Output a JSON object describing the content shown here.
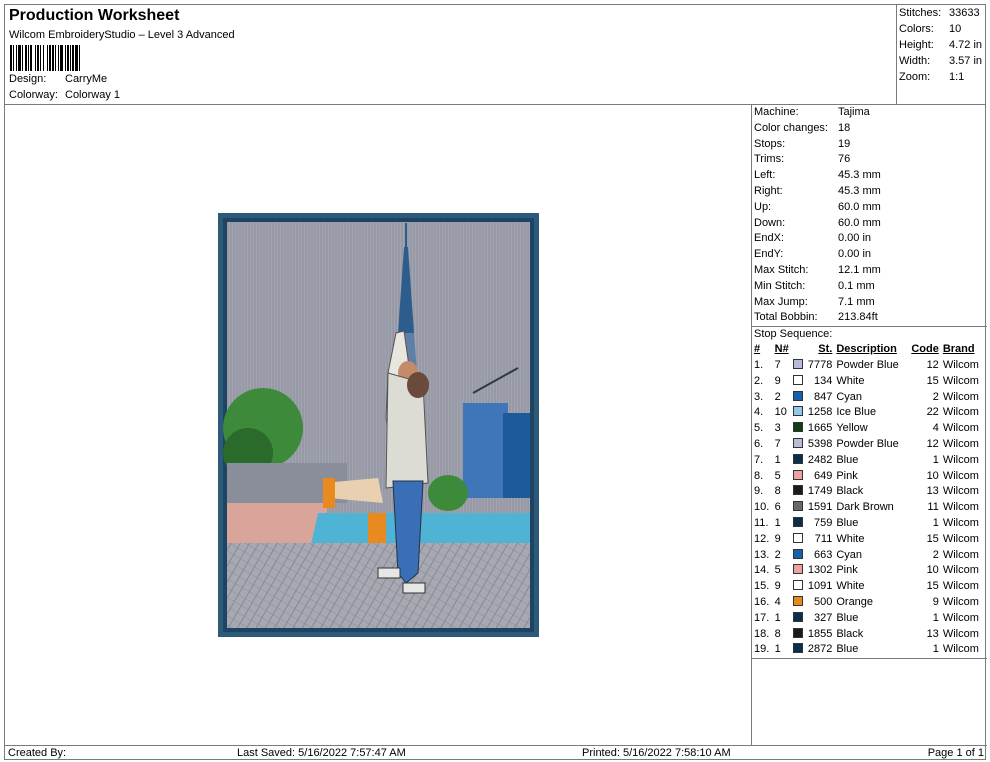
{
  "header": {
    "title": "Production Worksheet",
    "subtitle": "Wilcom EmbroideryStudio – Level 3 Advanced",
    "design_label": "Design:",
    "design_value": "CarryMe",
    "colorway_label": "Colorway:",
    "colorway_value": "Colorway 1"
  },
  "stats": [
    {
      "label": "Stitches:",
      "value": "33633"
    },
    {
      "label": "Colors:",
      "value": "10"
    },
    {
      "label": "Height:",
      "value": "4.72 in"
    },
    {
      "label": "Width:",
      "value": "3.57 in"
    },
    {
      "label": "Zoom:",
      "value": "1:1"
    }
  ],
  "machine_info": [
    {
      "label": "Machine:",
      "value": "Tajima"
    },
    {
      "label": "Color changes:",
      "value": "18"
    },
    {
      "label": "Stops:",
      "value": "19"
    },
    {
      "label": "Trims:",
      "value": "76"
    },
    {
      "label": "Left:",
      "value": "45.3 mm"
    },
    {
      "label": "Right:",
      "value": "45.3 mm"
    },
    {
      "label": "Up:",
      "value": "60.0 mm"
    },
    {
      "label": "Down:",
      "value": "60.0 mm"
    },
    {
      "label": "EndX:",
      "value": "0.00 in"
    },
    {
      "label": "EndY:",
      "value": "0.00 in"
    },
    {
      "label": "Max Stitch:",
      "value": "12.1 mm"
    },
    {
      "label": "Min Stitch:",
      "value": "0.1 mm"
    },
    {
      "label": "Max Jump:",
      "value": "7.1 mm"
    },
    {
      "label": "Total Bobbin:",
      "value": "213.84ft"
    }
  ],
  "stop_sequence": {
    "title": "Stop Sequence:",
    "columns": [
      "#",
      "N#",
      "St.",
      "Description",
      "Code",
      "Brand"
    ],
    "rows": [
      {
        "num": "1.",
        "n": "7",
        "color": "#b9bcd9",
        "st": "7778",
        "desc": "Powder Blue",
        "code": "12",
        "brand": "Wilcom"
      },
      {
        "num": "2.",
        "n": "9",
        "color": "#ffffff",
        "st": "134",
        "desc": "White",
        "code": "15",
        "brand": "Wilcom"
      },
      {
        "num": "3.",
        "n": "2",
        "color": "#1a5fae",
        "st": "847",
        "desc": "Cyan",
        "code": "2",
        "brand": "Wilcom"
      },
      {
        "num": "4.",
        "n": "10",
        "color": "#8fc9ea",
        "st": "1258",
        "desc": "Ice Blue",
        "code": "22",
        "brand": "Wilcom"
      },
      {
        "num": "5.",
        "n": "3",
        "color": "#123d12",
        "st": "1665",
        "desc": "Yellow",
        "code": "4",
        "brand": "Wilcom"
      },
      {
        "num": "6.",
        "n": "7",
        "color": "#b9bcd9",
        "st": "5398",
        "desc": "Powder Blue",
        "code": "12",
        "brand": "Wilcom"
      },
      {
        "num": "7.",
        "n": "1",
        "color": "#0d2d4e",
        "st": "2482",
        "desc": "Blue",
        "code": "1",
        "brand": "Wilcom"
      },
      {
        "num": "8.",
        "n": "5",
        "color": "#efa1a1",
        "st": "649",
        "desc": "Pink",
        "code": "10",
        "brand": "Wilcom"
      },
      {
        "num": "9.",
        "n": "8",
        "color": "#1b1b1b",
        "st": "1749",
        "desc": "Black",
        "code": "13",
        "brand": "Wilcom"
      },
      {
        "num": "10.",
        "n": "6",
        "color": "#6c6868",
        "st": "1591",
        "desc": "Dark Brown",
        "code": "11",
        "brand": "Wilcom"
      },
      {
        "num": "11.",
        "n": "1",
        "color": "#0d2d4e",
        "st": "759",
        "desc": "Blue",
        "code": "1",
        "brand": "Wilcom"
      },
      {
        "num": "12.",
        "n": "9",
        "color": "#ffffff",
        "st": "711",
        "desc": "White",
        "code": "15",
        "brand": "Wilcom"
      },
      {
        "num": "13.",
        "n": "2",
        "color": "#1a5fae",
        "st": "663",
        "desc": "Cyan",
        "code": "2",
        "brand": "Wilcom"
      },
      {
        "num": "14.",
        "n": "5",
        "color": "#efa1a1",
        "st": "1302",
        "desc": "Pink",
        "code": "10",
        "brand": "Wilcom"
      },
      {
        "num": "15.",
        "n": "9",
        "color": "#ffffff",
        "st": "1091",
        "desc": "White",
        "code": "15",
        "brand": "Wilcom"
      },
      {
        "num": "16.",
        "n": "4",
        "color": "#e88a1d",
        "st": "500",
        "desc": "Orange",
        "code": "9",
        "brand": "Wilcom"
      },
      {
        "num": "17.",
        "n": "1",
        "color": "#0d2d4e",
        "st": "327",
        "desc": "Blue",
        "code": "1",
        "brand": "Wilcom"
      },
      {
        "num": "18.",
        "n": "8",
        "color": "#1b1b1b",
        "st": "1855",
        "desc": "Black",
        "code": "13",
        "brand": "Wilcom"
      },
      {
        "num": "19.",
        "n": "1",
        "color": "#0d2d4e",
        "st": "2872",
        "desc": "Blue",
        "code": "1",
        "brand": "Wilcom"
      }
    ]
  },
  "footer": {
    "created_by": "Created By:",
    "last_saved": "Last Saved: 5/16/2022 7:57:47 AM",
    "printed": "Printed: 5/16/2022 7:58:10 AM",
    "page": "Page 1 of 1"
  },
  "colors": {
    "frame_border": "#2e5a7a",
    "sky": "#9a9ca8",
    "water": "#4fb3d6"
  }
}
